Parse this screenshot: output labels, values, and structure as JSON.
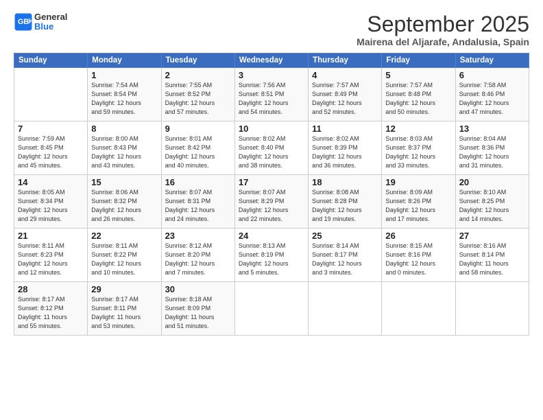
{
  "header": {
    "logo_line1": "General",
    "logo_line2": "Blue",
    "month": "September 2025",
    "location": "Mairena del Aljarafe, Andalusia, Spain"
  },
  "weekdays": [
    "Sunday",
    "Monday",
    "Tuesday",
    "Wednesday",
    "Thursday",
    "Friday",
    "Saturday"
  ],
  "weeks": [
    [
      {
        "day": "",
        "info": ""
      },
      {
        "day": "1",
        "info": "Sunrise: 7:54 AM\nSunset: 8:54 PM\nDaylight: 12 hours\nand 59 minutes."
      },
      {
        "day": "2",
        "info": "Sunrise: 7:55 AM\nSunset: 8:52 PM\nDaylight: 12 hours\nand 57 minutes."
      },
      {
        "day": "3",
        "info": "Sunrise: 7:56 AM\nSunset: 8:51 PM\nDaylight: 12 hours\nand 54 minutes."
      },
      {
        "day": "4",
        "info": "Sunrise: 7:57 AM\nSunset: 8:49 PM\nDaylight: 12 hours\nand 52 minutes."
      },
      {
        "day": "5",
        "info": "Sunrise: 7:57 AM\nSunset: 8:48 PM\nDaylight: 12 hours\nand 50 minutes."
      },
      {
        "day": "6",
        "info": "Sunrise: 7:58 AM\nSunset: 8:46 PM\nDaylight: 12 hours\nand 47 minutes."
      }
    ],
    [
      {
        "day": "7",
        "info": "Sunrise: 7:59 AM\nSunset: 8:45 PM\nDaylight: 12 hours\nand 45 minutes."
      },
      {
        "day": "8",
        "info": "Sunrise: 8:00 AM\nSunset: 8:43 PM\nDaylight: 12 hours\nand 43 minutes."
      },
      {
        "day": "9",
        "info": "Sunrise: 8:01 AM\nSunset: 8:42 PM\nDaylight: 12 hours\nand 40 minutes."
      },
      {
        "day": "10",
        "info": "Sunrise: 8:02 AM\nSunset: 8:40 PM\nDaylight: 12 hours\nand 38 minutes."
      },
      {
        "day": "11",
        "info": "Sunrise: 8:02 AM\nSunset: 8:39 PM\nDaylight: 12 hours\nand 36 minutes."
      },
      {
        "day": "12",
        "info": "Sunrise: 8:03 AM\nSunset: 8:37 PM\nDaylight: 12 hours\nand 33 minutes."
      },
      {
        "day": "13",
        "info": "Sunrise: 8:04 AM\nSunset: 8:36 PM\nDaylight: 12 hours\nand 31 minutes."
      }
    ],
    [
      {
        "day": "14",
        "info": "Sunrise: 8:05 AM\nSunset: 8:34 PM\nDaylight: 12 hours\nand 29 minutes."
      },
      {
        "day": "15",
        "info": "Sunrise: 8:06 AM\nSunset: 8:32 PM\nDaylight: 12 hours\nand 26 minutes."
      },
      {
        "day": "16",
        "info": "Sunrise: 8:07 AM\nSunset: 8:31 PM\nDaylight: 12 hours\nand 24 minutes."
      },
      {
        "day": "17",
        "info": "Sunrise: 8:07 AM\nSunset: 8:29 PM\nDaylight: 12 hours\nand 22 minutes."
      },
      {
        "day": "18",
        "info": "Sunrise: 8:08 AM\nSunset: 8:28 PM\nDaylight: 12 hours\nand 19 minutes."
      },
      {
        "day": "19",
        "info": "Sunrise: 8:09 AM\nSunset: 8:26 PM\nDaylight: 12 hours\nand 17 minutes."
      },
      {
        "day": "20",
        "info": "Sunrise: 8:10 AM\nSunset: 8:25 PM\nDaylight: 12 hours\nand 14 minutes."
      }
    ],
    [
      {
        "day": "21",
        "info": "Sunrise: 8:11 AM\nSunset: 8:23 PM\nDaylight: 12 hours\nand 12 minutes."
      },
      {
        "day": "22",
        "info": "Sunrise: 8:11 AM\nSunset: 8:22 PM\nDaylight: 12 hours\nand 10 minutes."
      },
      {
        "day": "23",
        "info": "Sunrise: 8:12 AM\nSunset: 8:20 PM\nDaylight: 12 hours\nand 7 minutes."
      },
      {
        "day": "24",
        "info": "Sunrise: 8:13 AM\nSunset: 8:19 PM\nDaylight: 12 hours\nand 5 minutes."
      },
      {
        "day": "25",
        "info": "Sunrise: 8:14 AM\nSunset: 8:17 PM\nDaylight: 12 hours\nand 3 minutes."
      },
      {
        "day": "26",
        "info": "Sunrise: 8:15 AM\nSunset: 8:16 PM\nDaylight: 12 hours\nand 0 minutes."
      },
      {
        "day": "27",
        "info": "Sunrise: 8:16 AM\nSunset: 8:14 PM\nDaylight: 11 hours\nand 58 minutes."
      }
    ],
    [
      {
        "day": "28",
        "info": "Sunrise: 8:17 AM\nSunset: 8:12 PM\nDaylight: 11 hours\nand 55 minutes."
      },
      {
        "day": "29",
        "info": "Sunrise: 8:17 AM\nSunset: 8:11 PM\nDaylight: 11 hours\nand 53 minutes."
      },
      {
        "day": "30",
        "info": "Sunrise: 8:18 AM\nSunset: 8:09 PM\nDaylight: 11 hours\nand 51 minutes."
      },
      {
        "day": "",
        "info": ""
      },
      {
        "day": "",
        "info": ""
      },
      {
        "day": "",
        "info": ""
      },
      {
        "day": "",
        "info": ""
      }
    ]
  ]
}
